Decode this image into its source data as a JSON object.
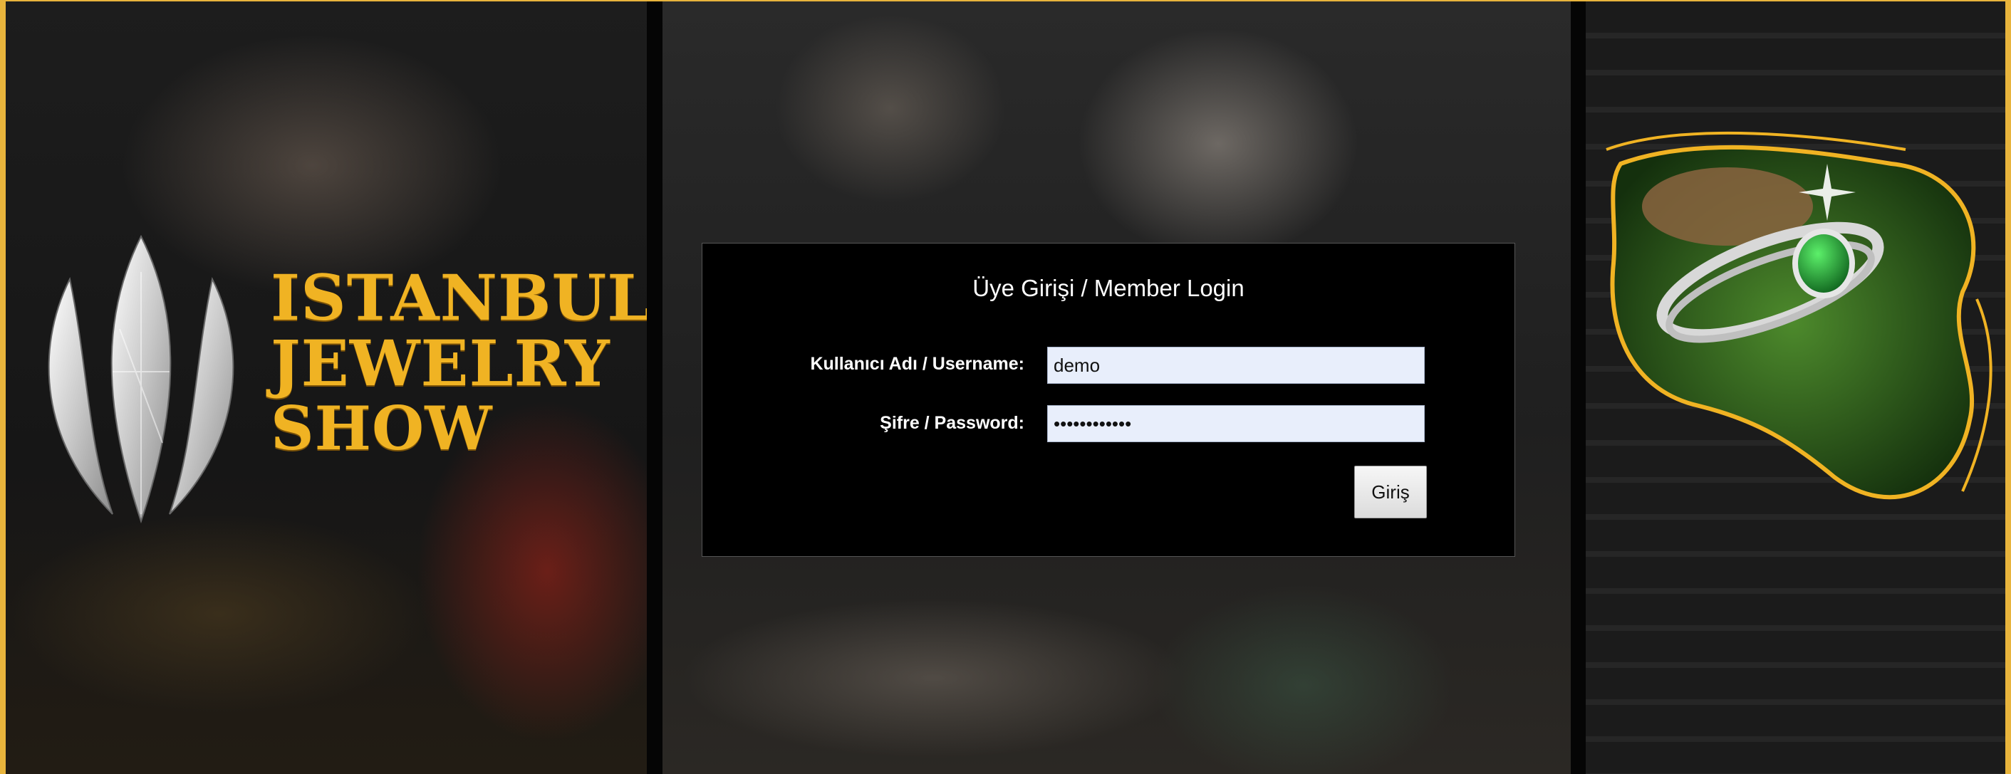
{
  "brand": {
    "line1": "ISTANBUL",
    "line2": "JEWELRY",
    "line3": "SHOW",
    "gold": "#f0b323",
    "frame_color": "#e8b43c"
  },
  "login": {
    "title": "Üye Girişi / Member Login",
    "username_label": "Kullanıcı Adı / Username:",
    "username_value": "demo",
    "password_label": "Şifre / Password:",
    "password_value": "demo12345678",
    "submit_label": "Giriş"
  }
}
